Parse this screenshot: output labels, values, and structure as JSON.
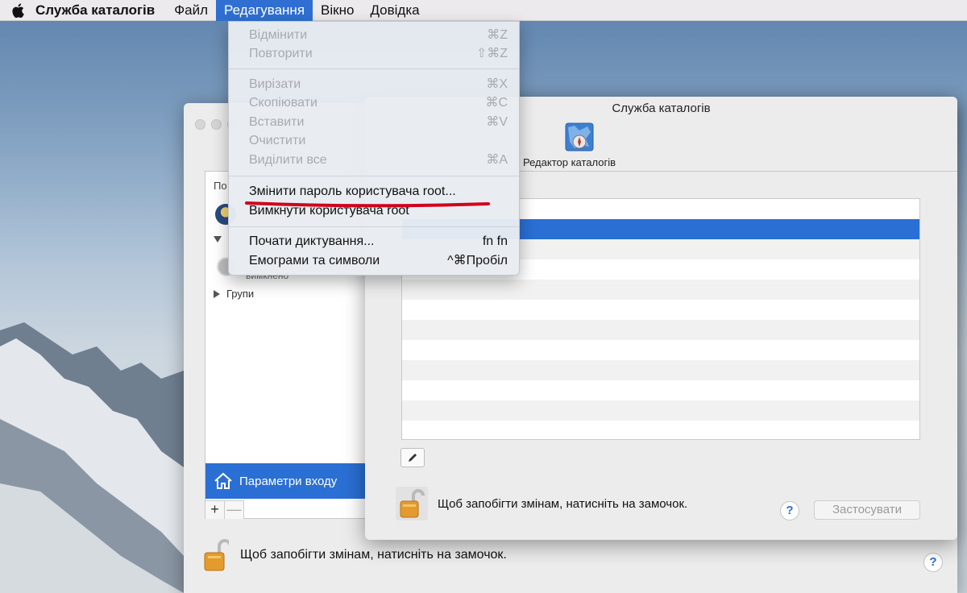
{
  "menubar": {
    "app_name": "Служба каталогів",
    "items": [
      "Файл",
      "Редагування",
      "Вікно",
      "Довідка"
    ]
  },
  "edit_menu": {
    "items": [
      {
        "label": "Відмінити",
        "shortcut": "⌘Z",
        "enabled": false
      },
      {
        "label": "Повторити",
        "shortcut": "⇧⌘Z",
        "enabled": false
      },
      {
        "label": "Вирізати",
        "shortcut": "⌘X",
        "enabled": false
      },
      {
        "label": "Скопіювати",
        "shortcut": "⌘C",
        "enabled": false
      },
      {
        "label": "Вставити",
        "shortcut": "⌘V",
        "enabled": false
      },
      {
        "label": "Очистити",
        "shortcut": "",
        "enabled": false
      },
      {
        "label": "Виділити все",
        "shortcut": "⌘A",
        "enabled": false
      },
      {
        "label": "Змінити пароль користувача root...",
        "shortcut": "",
        "enabled": true
      },
      {
        "label": "Вимкнути користувача root",
        "shortcut": "",
        "enabled": true
      },
      {
        "label": "Почати диктування...",
        "shortcut": "fn fn",
        "enabled": true
      },
      {
        "label": "Емограми та символи",
        "shortcut": "^⌘Пробіл",
        "enabled": true
      }
    ],
    "highlight_color": "#d0021b"
  },
  "back_window": {
    "sidebar": {
      "header": "По",
      "disabled_label": "вимкнено",
      "groups_label": "Групи",
      "login_options": "Параметри входу",
      "add_label": "+",
      "remove_label": "—"
    },
    "lock_text": "Щоб запобігти змінам, натисніть на замочок.",
    "help_label": "?"
  },
  "front_window": {
    "title": "Служба каталогів",
    "toolbar_label": "Редактор каталогів",
    "lock_text": "Щоб запобігти змінам, натисніть на замочок.",
    "help_label": "?",
    "apply_label": "Застосувати"
  },
  "colors": {
    "accent": "#2a6fd3",
    "menu_active": "#2f6fd1"
  }
}
